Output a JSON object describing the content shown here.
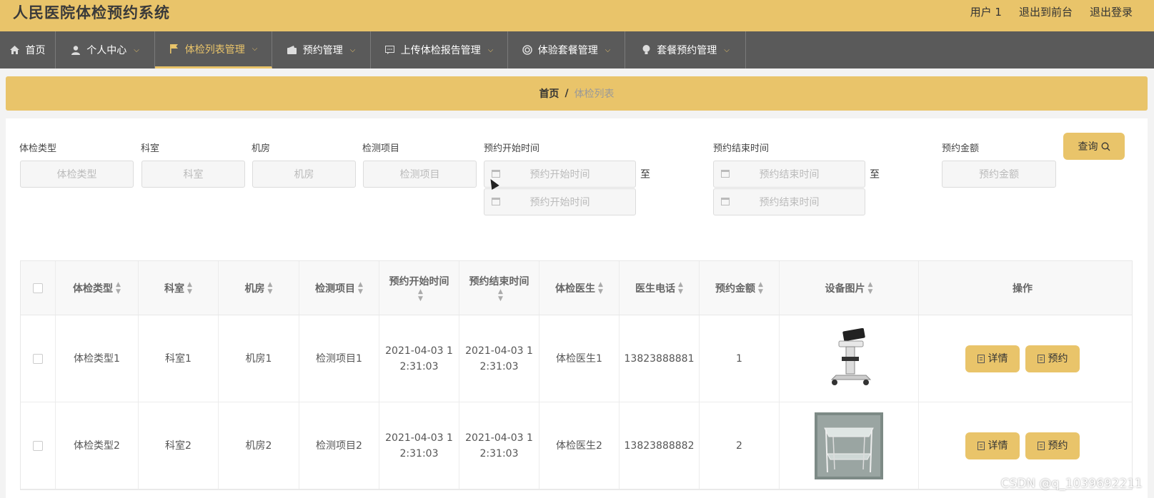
{
  "app": {
    "title": "人民医院体检预约系统",
    "user_label": "用户 1",
    "exit_front": "退出到前台",
    "logout": "退出登录"
  },
  "nav": [
    {
      "label": "首页",
      "icon": "home-icon",
      "caret": false
    },
    {
      "label": "个人中心",
      "icon": "user-icon",
      "caret": true
    },
    {
      "label": "体检列表管理",
      "icon": "flag-icon",
      "caret": true,
      "active": true
    },
    {
      "label": "预约管理",
      "icon": "wallet-icon",
      "caret": true
    },
    {
      "label": "上传体检报告管理",
      "icon": "message-icon",
      "caret": true
    },
    {
      "label": "体验套餐管理",
      "icon": "circle-icon",
      "caret": true
    },
    {
      "label": "套餐预约管理",
      "icon": "bulb-icon",
      "caret": true
    }
  ],
  "breadcrumb": {
    "home": "首页",
    "sep": "/",
    "current": "体检列表"
  },
  "filters": {
    "type": {
      "label": "体检类型",
      "placeholder": "体检类型"
    },
    "dept": {
      "label": "科室",
      "placeholder": "科室"
    },
    "room": {
      "label": "机房",
      "placeholder": "机房"
    },
    "item": {
      "label": "检测项目",
      "placeholder": "检测项目"
    },
    "start": {
      "label": "预约开始时间",
      "placeholder": "预约开始时间",
      "to": "至"
    },
    "end": {
      "label": "预约结束时间",
      "placeholder": "预约结束时间",
      "to": "至"
    },
    "amount": {
      "label": "预约金额",
      "placeholder": "预约金额"
    },
    "query_label": "查询"
  },
  "table": {
    "headers": {
      "type": "体检类型",
      "dept": "科室",
      "room": "机房",
      "item": "检测项目",
      "start": "预约开始时间",
      "end": "预约结束时间",
      "doctor": "体检医生",
      "phone": "医生电话",
      "amount": "预约金额",
      "image": "设备图片",
      "ops": "操作"
    },
    "rows": [
      {
        "type": "体检类型1",
        "dept": "科室1",
        "room": "机房1",
        "item": "检测项目1",
        "start_a": "2021-04-03 1",
        "start_b": "2:31:03",
        "end_a": "2021-04-03 1",
        "end_b": "2:31:03",
        "doctor": "体检医生1",
        "phone": "13823888881",
        "amount": "1"
      },
      {
        "type": "体检类型2",
        "dept": "科室2",
        "room": "机房2",
        "item": "检测项目2",
        "start_a": "2021-04-03 1",
        "start_b": "2:31:03",
        "end_a": "2021-04-03 1",
        "end_b": "2:31:03",
        "doctor": "体检医生2",
        "phone": "13823888882",
        "amount": "2"
      }
    ],
    "detail_label": "详情",
    "book_label": "预约"
  },
  "watermark": "CSDN @q_1039692211"
}
